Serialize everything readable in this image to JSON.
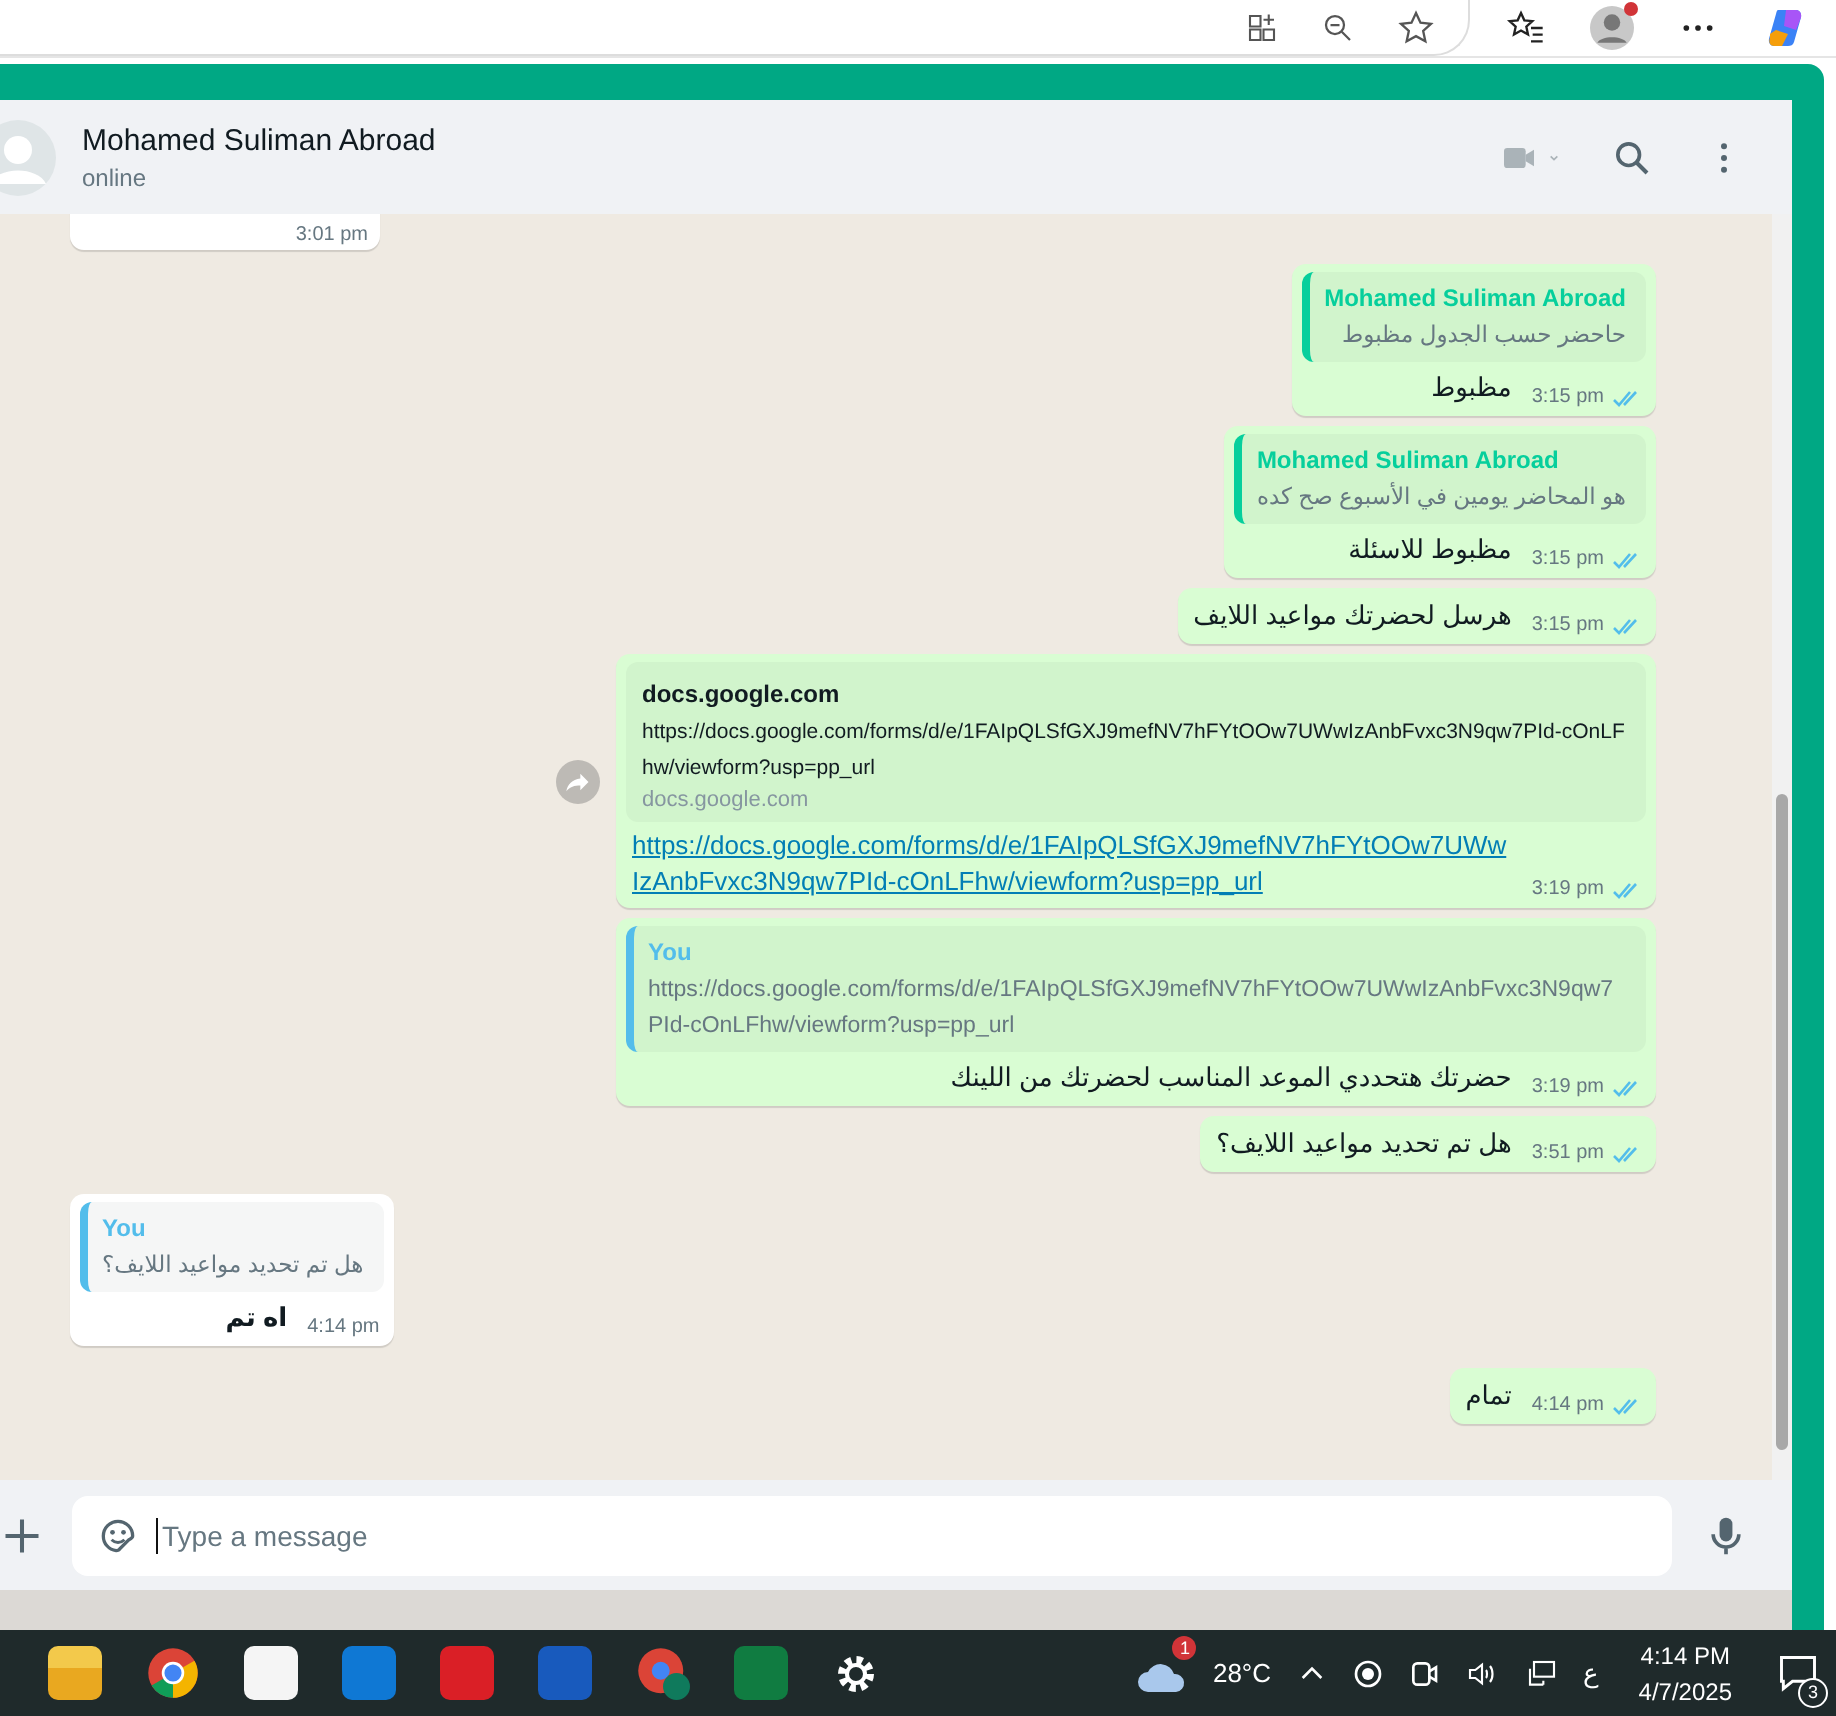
{
  "chat_header": {
    "name": "Mohamed Suliman Abroad",
    "status": "online"
  },
  "partial_message": {
    "time": "3:01 pm"
  },
  "messages": [
    {
      "kind": "reply",
      "outgoing": true,
      "read": true,
      "quote": {
        "author": "Mohamed Suliman Abroad",
        "color": "#06cf9c",
        "text": "حاحضر حسب الجدول مظبوط"
      },
      "text": "مظبوط",
      "time": "3:15 pm"
    },
    {
      "kind": "reply",
      "outgoing": true,
      "read": true,
      "quote": {
        "author": "Mohamed Suliman Abroad",
        "color": "#06cf9c",
        "text": "هو المحاضر يومين في الأسبوع صح كده"
      },
      "text": "مظبوط للاسئلة",
      "time": "3:15 pm"
    },
    {
      "kind": "text",
      "outgoing": true,
      "read": true,
      "text": "هرسل لحضرتك مواعيد اللايف",
      "time": "3:15 pm"
    },
    {
      "kind": "link",
      "outgoing": true,
      "read": true,
      "preview": {
        "title": "docs.google.com",
        "description": "https://docs.google.com/forms/d/e/1FAIpQLSfGXJ9mefNV7hFYtOOw7UWwIzAnbFvxc3N9qw7PId-cOnLFhw/viewform?usp=pp_url",
        "domain": "docs.google.com"
      },
      "text": "https://docs.google.com/forms/d/e/1FAIpQLSfGXJ9mefNV7hFYtOOw7UWwIzAnbFvxc3N9qw7PId-cOnLFhw/viewform?usp=pp_url",
      "time": "3:19 pm"
    },
    {
      "kind": "reply",
      "outgoing": true,
      "read": true,
      "quote": {
        "author": "You",
        "color": "#53bdeb",
        "text": "https://docs.google.com/forms/d/e/1FAIpQLSfGXJ9mefNV7hFYtOOw7UWwIzAnbFvxc3N9qw7PId-cOnLFhw/viewform?usp=pp_url"
      },
      "text": "حضرتك هتحددي الموعد المناسب لحضرتك من اللينك",
      "time": "3:19 pm"
    },
    {
      "kind": "text",
      "outgoing": true,
      "read": true,
      "text": "هل تم تحديد مواعيد اللايف؟",
      "time": "3:51 pm"
    },
    {
      "kind": "reply",
      "outgoing": false,
      "quote": {
        "author": "You",
        "color": "#53bdeb",
        "text": "هل تم تحديد مواعيد اللايف؟"
      },
      "text": "اه تم",
      "time": "4:14 pm"
    },
    {
      "kind": "text",
      "outgoing": true,
      "read": true,
      "text": "تمام",
      "time": "4:14 pm"
    }
  ],
  "composer": {
    "placeholder": "Type a message"
  },
  "taskbar": {
    "weather": {
      "badge": "1",
      "temperature": "28°C"
    },
    "language": "ع",
    "time": "4:14 PM",
    "date": "4/7/2025",
    "notifications": "3"
  }
}
